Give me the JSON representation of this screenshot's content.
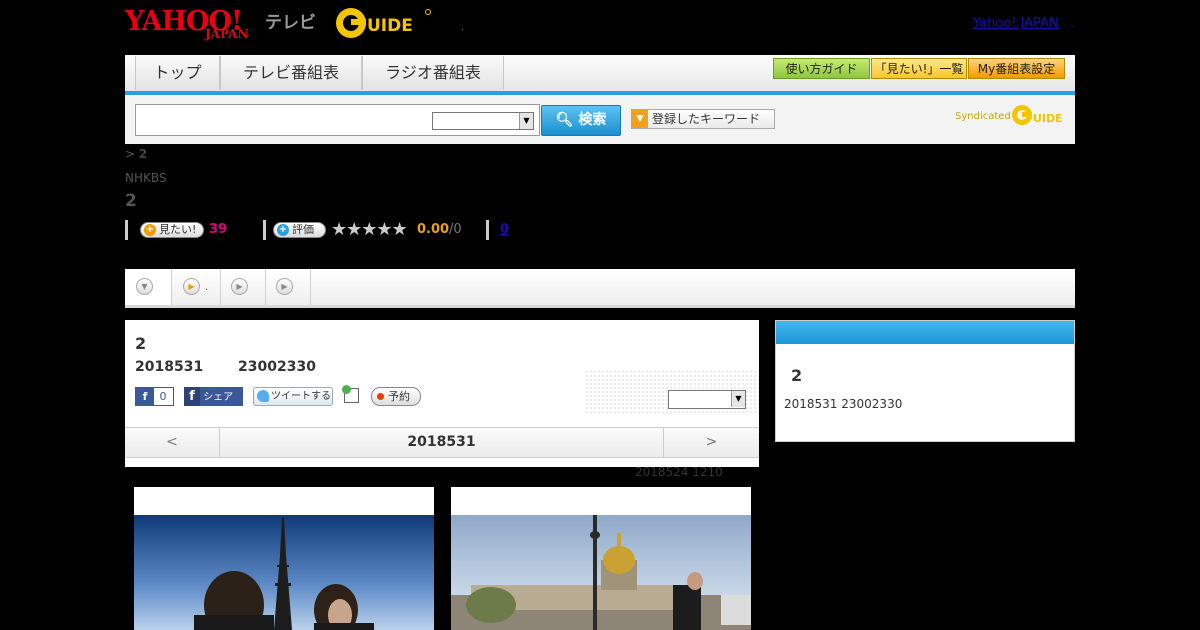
{
  "header": {
    "logo_yahoo": "YAHOO!",
    "logo_japan": "JAPAN",
    "logo_tv": "テレビ",
    "logo_gguide": "G-GUIDE",
    "top_dot": ".",
    "yahoo_japan_link": "Yahoo! JAPAN",
    "yahoo_japan_dot": "."
  },
  "nav": {
    "tabs": [
      "トップ",
      "テレビ番組表",
      "ラジオ番組表"
    ],
    "buttons": [
      "使い方ガイド",
      "「見たい!」一覧",
      "My番組表設定"
    ]
  },
  "search": {
    "input_value": "",
    "select_value": "",
    "search_button": "検索",
    "keyword_button": "登録したキーワード",
    "syndicated": "Syndicated",
    "syndicated_logo": "G-GUIDE"
  },
  "program": {
    "breadcrumb_sep": ">",
    "breadcrumb_current": "2",
    "channel": "NHKBS",
    "title": "2",
    "want_label": "見たい!",
    "want_count": "39",
    "rate_label": "評価",
    "stars": "★★★★★",
    "score": "0.00",
    "score_of": "/0",
    "review_count": "0"
  },
  "tabs": [
    {
      "label": ""
    },
    {
      "label": "."
    },
    {
      "label": ""
    },
    {
      "label": ""
    }
  ],
  "detail": {
    "title": "2",
    "date": "2018531",
    "time": "23002330",
    "fb_like": "f",
    "fb_count": "0",
    "fb_share": "シェア",
    "tweet": "ツイートする",
    "reserve": "予約",
    "select_value": "",
    "nav_prev": "<",
    "nav_date": "2018531",
    "nav_next": ">"
  },
  "updated": "2018524  1210",
  "side": {
    "header": "",
    "title": "2",
    "info": "2018531  23002330"
  },
  "colors": {
    "accent_blue": "#2aa1de",
    "yahoo_red": "#e60012",
    "want_pink": "#e0007a",
    "score_orange": "#e8a020"
  }
}
